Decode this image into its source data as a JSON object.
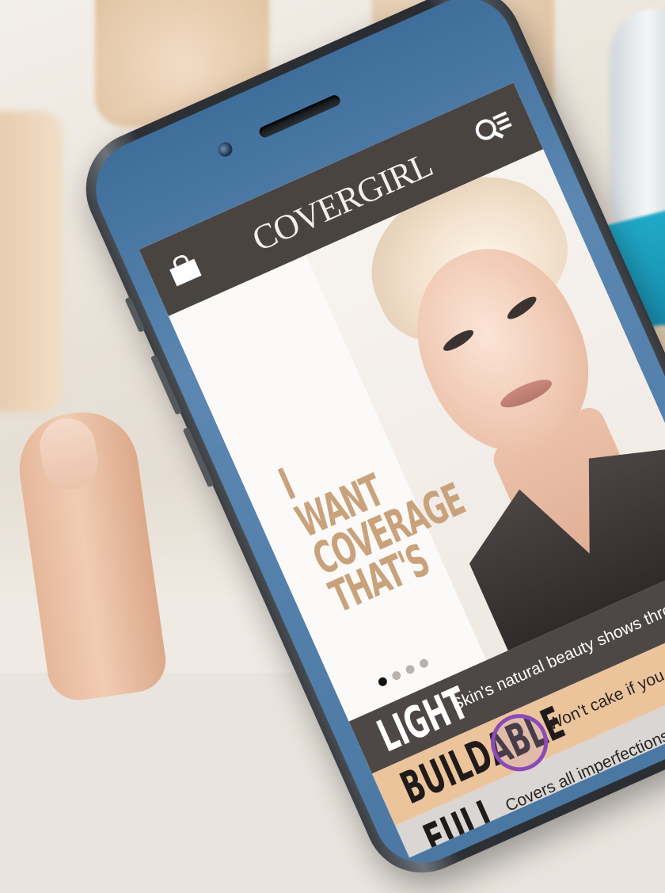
{
  "app": {
    "brand": "COVERGIRL",
    "icons": {
      "left": "shopping-bag-icon",
      "right": "search-menu-icon"
    }
  },
  "hero": {
    "headline_lines": [
      "I WANT",
      "COVERAGE",
      "THAT'S"
    ],
    "carousel": {
      "total": 4,
      "active_index": 0
    }
  },
  "options": [
    {
      "word": "LIGHT",
      "description": "Skin's natural beauty shows through"
    },
    {
      "word": "BUILDABLE",
      "description": "Won't cake if you apply in layers"
    },
    {
      "word": "FULL",
      "description": "Covers all imperfections"
    }
  ],
  "colors": {
    "headline": "#c9a27c",
    "bar_dark": "#4d4745",
    "bar_peach": "#ecc49c",
    "touch_ring": "#8a4bb6"
  }
}
